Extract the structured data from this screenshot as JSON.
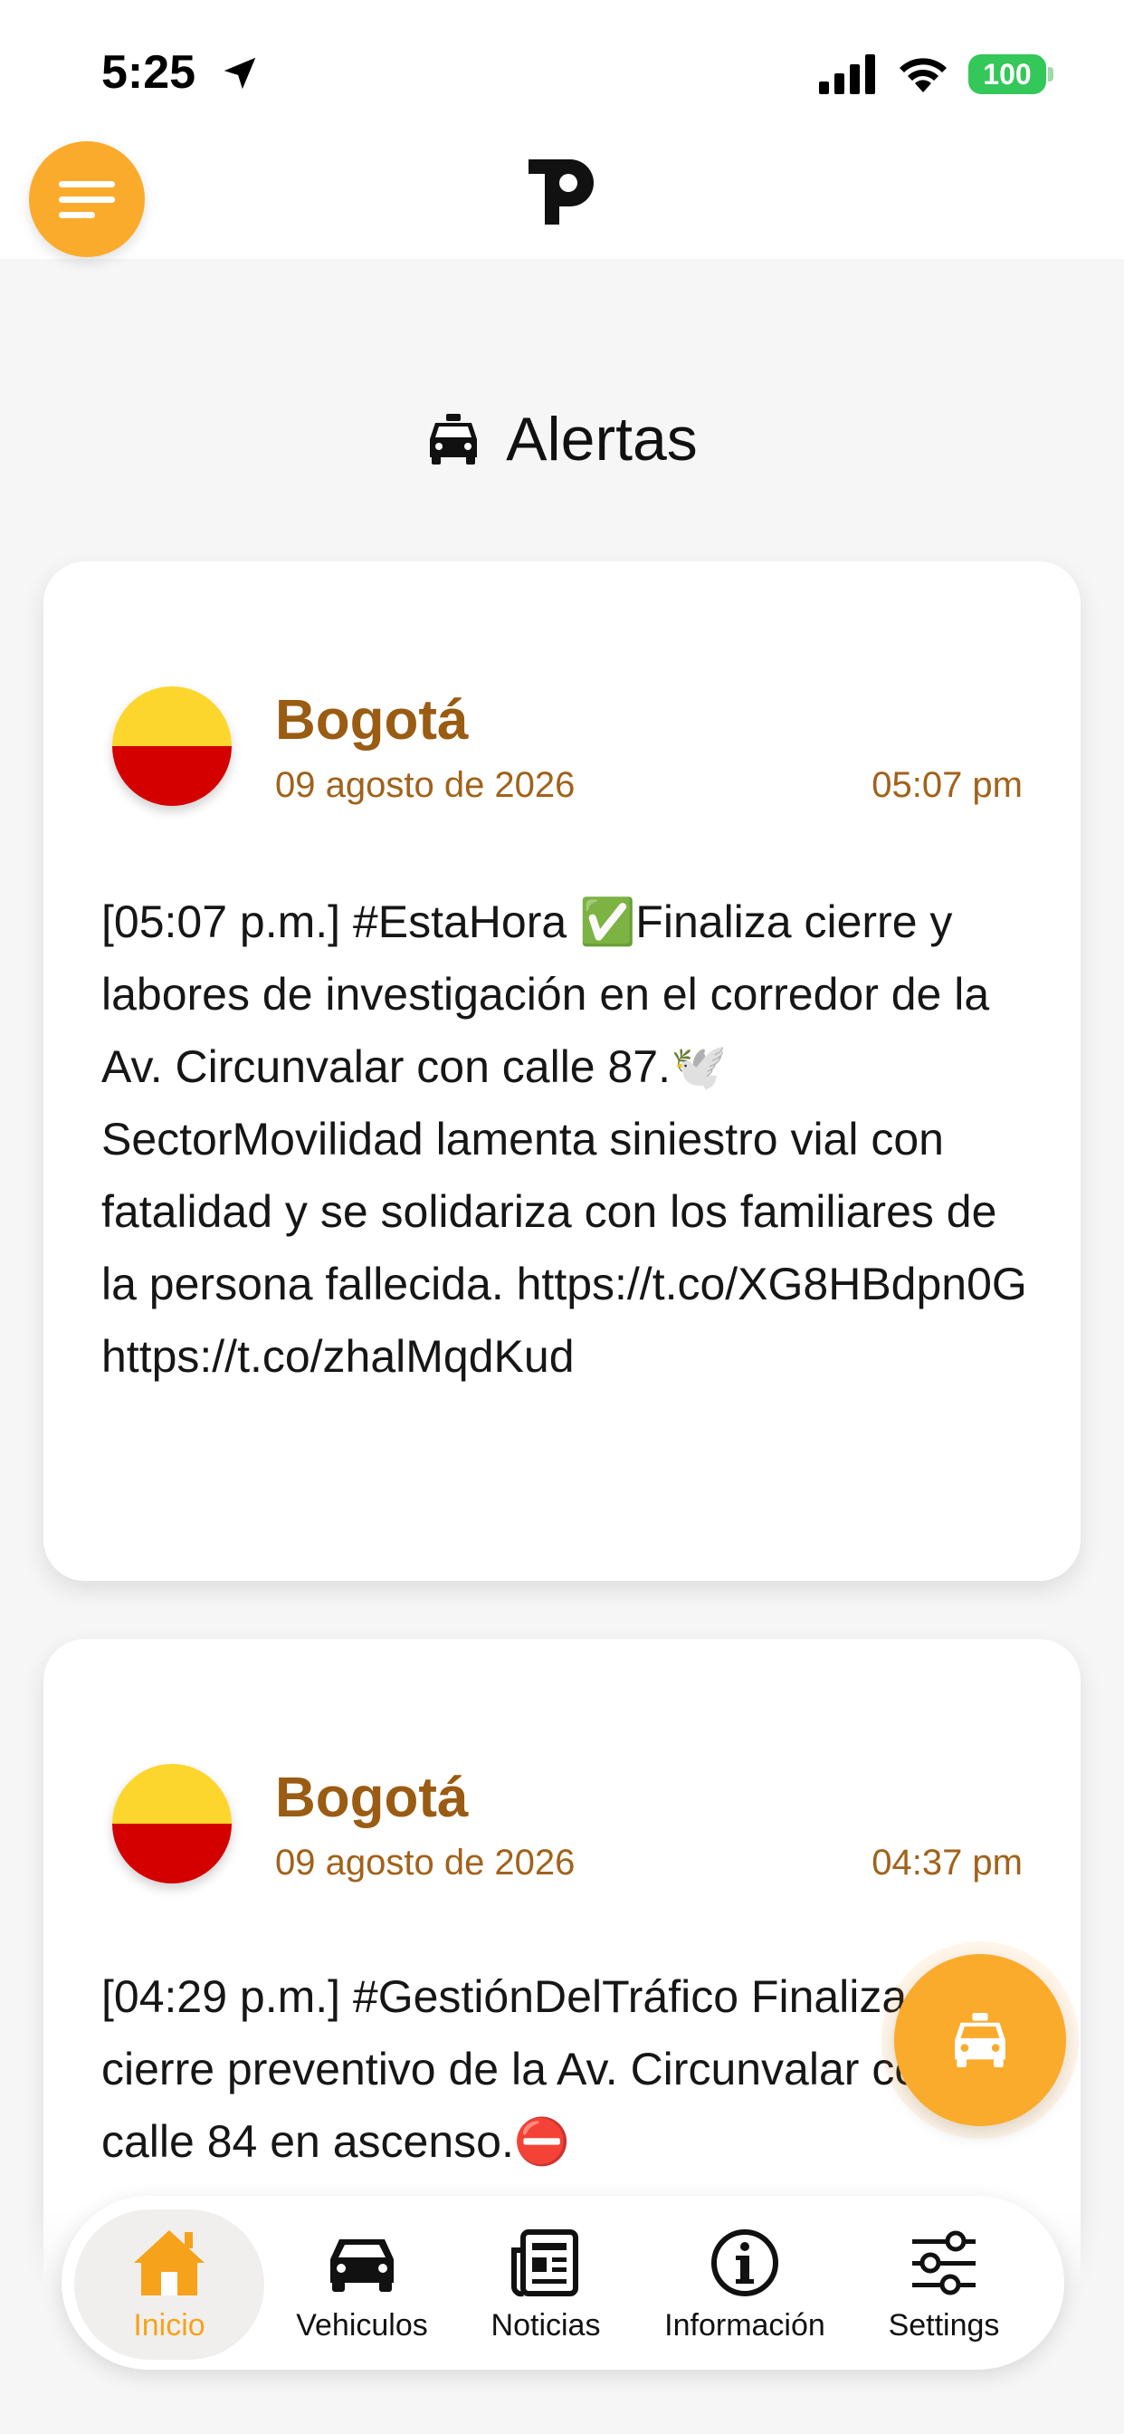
{
  "status_bar": {
    "time": "5:25",
    "battery": "100"
  },
  "header": {
    "menu_icon": "hamburger-icon",
    "logo_icon": "p-logo-icon"
  },
  "section": {
    "title": "Alertas",
    "icon": "taxi-icon"
  },
  "alerts": [
    {
      "city": "Bogotá",
      "date": "09 agosto de 2026",
      "time": "05:07 pm",
      "text": "[05:07 p.m.] #EstaHora ✅Finaliza cierre y labores de investigación en el corredor de la Av. Circunvalar con calle 87.🕊️SectorMovilidad lamenta siniestro vial con fatalidad y se solidariza con los familiares de la persona fallecida. https://t.co/XG8HBdpn0G https://t.co/zhalMqdKud"
    },
    {
      "city": "Bogotá",
      "date": "09 agosto de 2026",
      "time": "04:37 pm",
      "text": "[04:29 p.m.] #GestiónDelTráfico Finaliza cierre preventivo de la Av. Circunvalar con calle 84 en ascenso.⛔"
    }
  ],
  "nav": {
    "items": [
      {
        "label": "Inicio",
        "icon": "home-icon",
        "active": true
      },
      {
        "label": "Vehiculos",
        "icon": "car-icon",
        "active": false
      },
      {
        "label": "Noticias",
        "icon": "newspaper-icon",
        "active": false
      },
      {
        "label": "Información",
        "icon": "info-icon",
        "active": false
      },
      {
        "label": "Settings",
        "icon": "sliders-icon",
        "active": false
      }
    ]
  },
  "colors": {
    "accent": "#fbab2c",
    "city_text": "#9a5b13",
    "flag_yellow": "#fcd62c",
    "flag_red": "#d40000",
    "battery": "#34c759"
  }
}
